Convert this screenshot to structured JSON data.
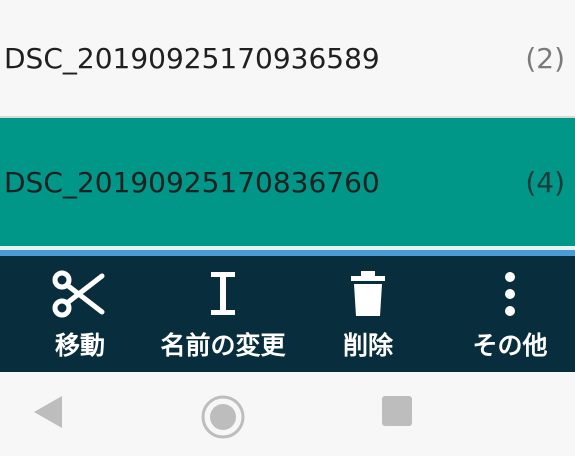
{
  "list": {
    "items": [
      {
        "name": "DSC_20190925170936589",
        "count": "(2)"
      },
      {
        "name": "DSC_20190925170836760",
        "count": "(4)"
      }
    ]
  },
  "toolbar": {
    "move_label": "移動",
    "rename_label": "名前の変更",
    "delete_label": "削除",
    "more_label": "その他",
    "icons": [
      "scissors-icon",
      "text-cursor-icon",
      "trash-icon",
      "more-vertical-icon"
    ]
  },
  "navbar": {
    "icons": [
      "back-triangle-icon",
      "home-circle-icon",
      "recents-square-icon"
    ]
  },
  "colors": {
    "selected_row": "#009688",
    "toolbar_bg": "#082e3e",
    "accent_line": "#4a9bd6"
  }
}
